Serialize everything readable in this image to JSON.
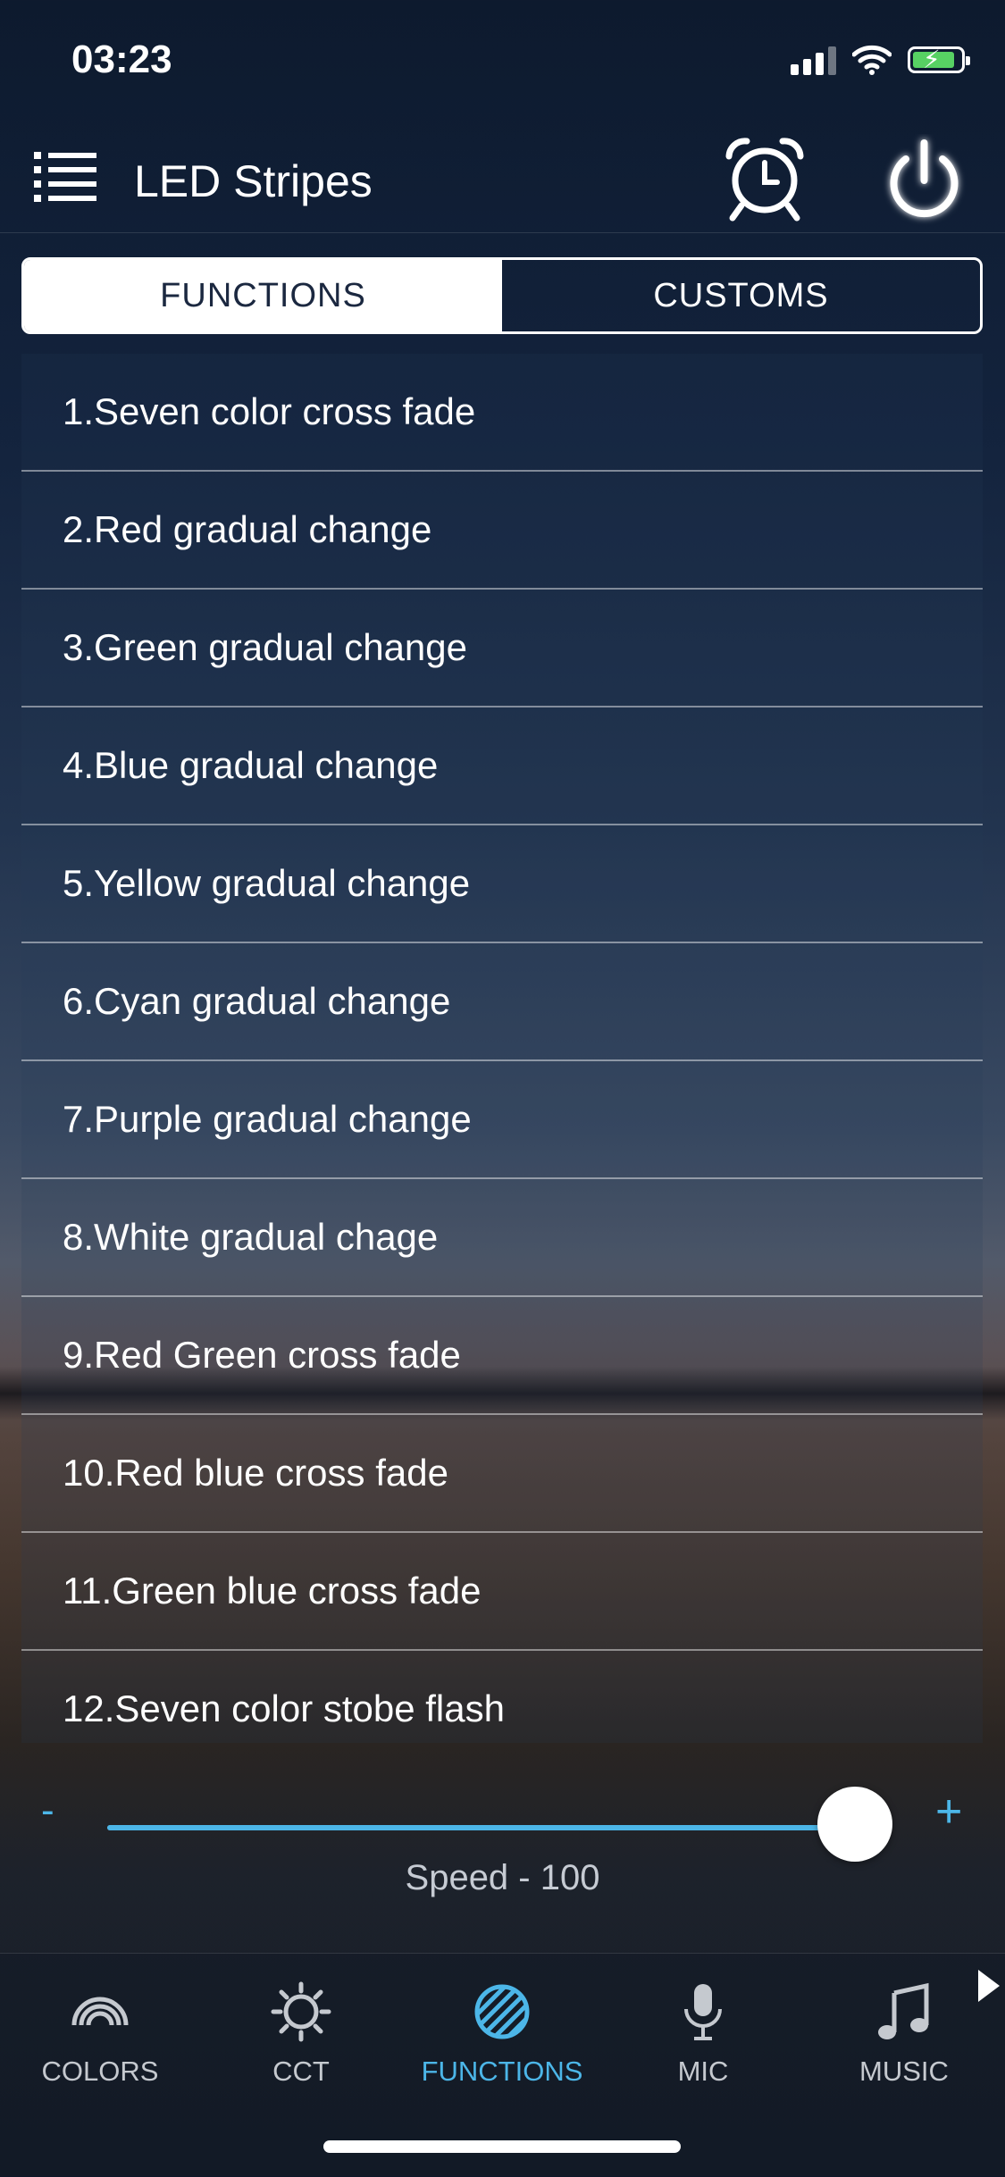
{
  "status_bar": {
    "time": "03:23"
  },
  "header": {
    "title": "LED Stripes"
  },
  "segments": {
    "functions": "FUNCTIONS",
    "customs": "CUSTOMS"
  },
  "functions": [
    "1.Seven color cross fade",
    "2.Red gradual change",
    "3.Green gradual change",
    "4.Blue gradual change",
    "5.Yellow gradual change",
    "6.Cyan gradual change",
    "7.Purple gradual change",
    "8.White gradual chage",
    "9.Red Green cross fade",
    "10.Red blue cross fade",
    "11.Green blue cross fade",
    "12.Seven color stobe flash"
  ],
  "speed": {
    "minus": "-",
    "plus": "+",
    "label": "Speed - 100",
    "value": 100,
    "max": 100
  },
  "tabbar": {
    "tabs": [
      {
        "label": "COLORS",
        "icon": "rainbow-icon"
      },
      {
        "label": "CCT",
        "icon": "sun-icon"
      },
      {
        "label": "FUNCTIONS",
        "icon": "striped-circle-icon",
        "active": true
      },
      {
        "label": "MIC",
        "icon": "microphone-icon"
      },
      {
        "label": "MUSIC",
        "icon": "music-note-icon"
      }
    ]
  },
  "colors": {
    "accent": "#4cb6e8",
    "battery": "#57d163"
  }
}
